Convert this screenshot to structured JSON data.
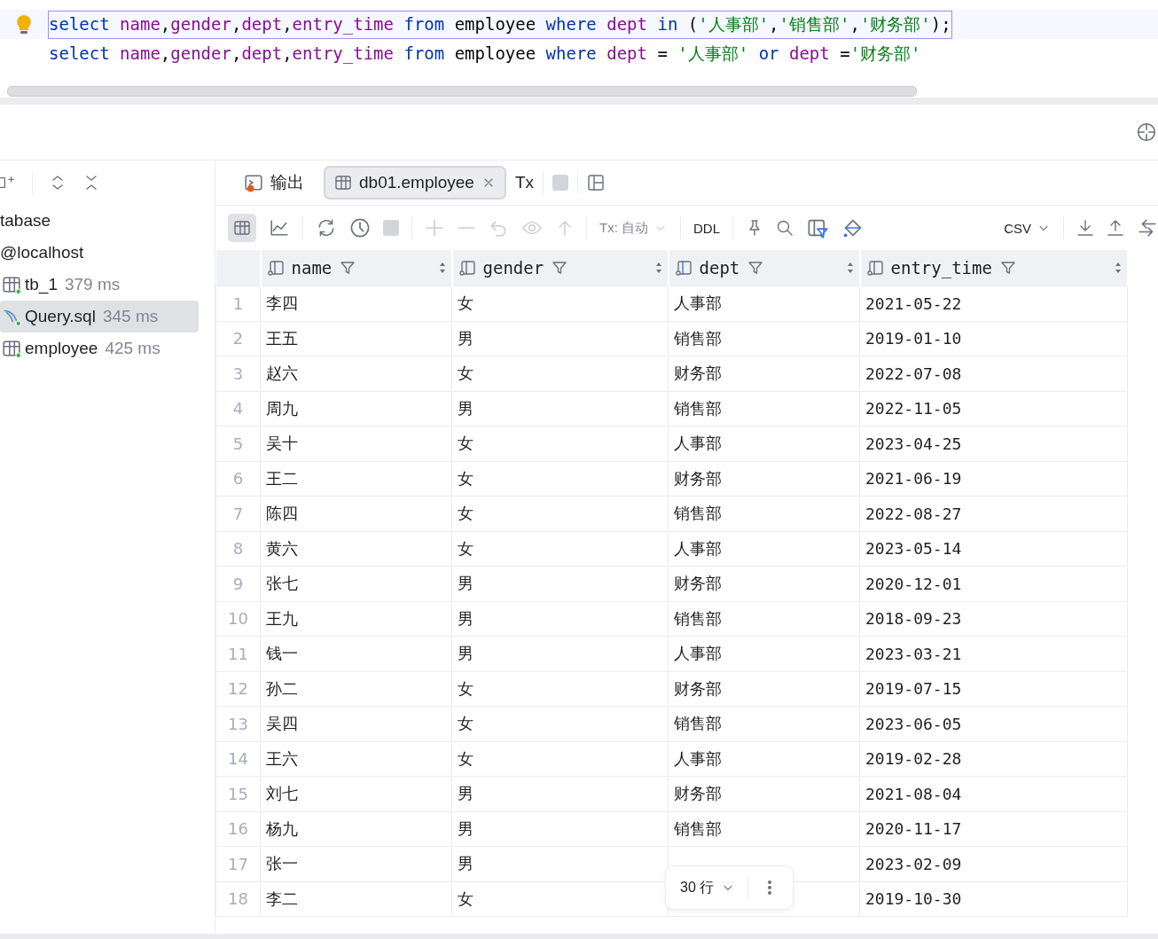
{
  "editor": {
    "lines": [
      {
        "current": true,
        "tokens": [
          {
            "kind": "kw",
            "text": "select "
          },
          {
            "kind": "col",
            "text": "name"
          },
          {
            "kind": "plain",
            "text": ","
          },
          {
            "kind": "col",
            "text": "gender"
          },
          {
            "kind": "plain",
            "text": ","
          },
          {
            "kind": "col",
            "text": "dept"
          },
          {
            "kind": "plain",
            "text": ","
          },
          {
            "kind": "col",
            "text": "entry_time"
          },
          {
            "kind": "kw",
            "text": " from"
          },
          {
            "kind": "plain",
            "text": " employee "
          },
          {
            "kind": "kw",
            "text": "where "
          },
          {
            "kind": "col",
            "text": "dept"
          },
          {
            "kind": "kw",
            "text": " in"
          },
          {
            "kind": "plain",
            "text": " ("
          },
          {
            "kind": "str",
            "text": "'人事部'"
          },
          {
            "kind": "plain",
            "text": ","
          },
          {
            "kind": "str",
            "text": "'销售部'"
          },
          {
            "kind": "plain",
            "text": ","
          },
          {
            "kind": "str",
            "text": "'财务部'"
          },
          {
            "kind": "plain",
            "text": ");"
          }
        ]
      },
      {
        "current": false,
        "tokens": [
          {
            "kind": "kw",
            "text": "select "
          },
          {
            "kind": "col",
            "text": "name"
          },
          {
            "kind": "plain",
            "text": ","
          },
          {
            "kind": "col",
            "text": "gender"
          },
          {
            "kind": "plain",
            "text": ","
          },
          {
            "kind": "col",
            "text": "dept"
          },
          {
            "kind": "plain",
            "text": ","
          },
          {
            "kind": "col",
            "text": "entry_time"
          },
          {
            "kind": "kw",
            "text": " from"
          },
          {
            "kind": "plain",
            "text": " employee "
          },
          {
            "kind": "kw",
            "text": "where "
          },
          {
            "kind": "col",
            "text": "dept"
          },
          {
            "kind": "plain",
            "text": " = "
          },
          {
            "kind": "str",
            "text": "'人事部'"
          },
          {
            "kind": "kw",
            "text": " or "
          },
          {
            "kind": "col",
            "text": "dept"
          },
          {
            "kind": "plain",
            "text": " ="
          },
          {
            "kind": "str",
            "text": "'财务部'"
          }
        ]
      }
    ]
  },
  "sidebar": {
    "items": [
      {
        "kind": "text",
        "label": "tabase",
        "selected": false
      },
      {
        "kind": "text",
        "label": "@localhost",
        "selected": false
      },
      {
        "kind": "table",
        "label": "tb_1",
        "time": "379 ms",
        "selected": false
      },
      {
        "kind": "query",
        "label": "Query.sql",
        "time": "345 ms",
        "selected": true
      },
      {
        "kind": "table",
        "label": "employee",
        "time": "425 ms",
        "selected": false
      }
    ]
  },
  "tabs": [
    {
      "kind": "output",
      "label": "输出",
      "selected": false
    },
    {
      "kind": "table",
      "label": "db01.employee",
      "selected": true
    }
  ],
  "tx_label": "Tx",
  "toolbar": {
    "tx_mode": "Tx: 自动",
    "ddl": "DDL",
    "format": "CSV"
  },
  "table": {
    "columns": [
      "name",
      "gender",
      "dept",
      "entry_time"
    ],
    "rows": [
      {
        "num": "1",
        "name": "李四",
        "gender": "女",
        "dept": "人事部",
        "entry_time": "2021-05-22"
      },
      {
        "num": "2",
        "name": "王五",
        "gender": "男",
        "dept": "销售部",
        "entry_time": "2019-01-10"
      },
      {
        "num": "3",
        "name": "赵六",
        "gender": "女",
        "dept": "财务部",
        "entry_time": "2022-07-08"
      },
      {
        "num": "4",
        "name": "周九",
        "gender": "男",
        "dept": "销售部",
        "entry_time": "2022-11-05"
      },
      {
        "num": "5",
        "name": "吴十",
        "gender": "女",
        "dept": "人事部",
        "entry_time": "2023-04-25"
      },
      {
        "num": "6",
        "name": "王二",
        "gender": "女",
        "dept": "财务部",
        "entry_time": "2021-06-19"
      },
      {
        "num": "7",
        "name": "陈四",
        "gender": "女",
        "dept": "销售部",
        "entry_time": "2022-08-27"
      },
      {
        "num": "8",
        "name": "黄六",
        "gender": "女",
        "dept": "人事部",
        "entry_time": "2023-05-14"
      },
      {
        "num": "9",
        "name": "张七",
        "gender": "男",
        "dept": "财务部",
        "entry_time": "2020-12-01"
      },
      {
        "num": "10",
        "name": "王九",
        "gender": "男",
        "dept": "销售部",
        "entry_time": "2018-09-23"
      },
      {
        "num": "11",
        "name": "钱一",
        "gender": "男",
        "dept": "人事部",
        "entry_time": "2023-03-21"
      },
      {
        "num": "12",
        "name": "孙二",
        "gender": "女",
        "dept": "财务部",
        "entry_time": "2019-07-15"
      },
      {
        "num": "13",
        "name": "吴四",
        "gender": "女",
        "dept": "销售部",
        "entry_time": "2023-06-05"
      },
      {
        "num": "14",
        "name": "王六",
        "gender": "女",
        "dept": "人事部",
        "entry_time": "2019-02-28"
      },
      {
        "num": "15",
        "name": "刘七",
        "gender": "男",
        "dept": "财务部",
        "entry_time": "2021-08-04"
      },
      {
        "num": "16",
        "name": "杨九",
        "gender": "男",
        "dept": "销售部",
        "entry_time": "2020-11-17"
      },
      {
        "num": "17",
        "name": "张一",
        "gender": "男",
        "entry_time": "2023-02-09"
      },
      {
        "num": "18",
        "name": "李二",
        "gender": "女",
        "entry_time": "2019-10-30"
      }
    ]
  },
  "pager": {
    "rows": "30 行"
  }
}
